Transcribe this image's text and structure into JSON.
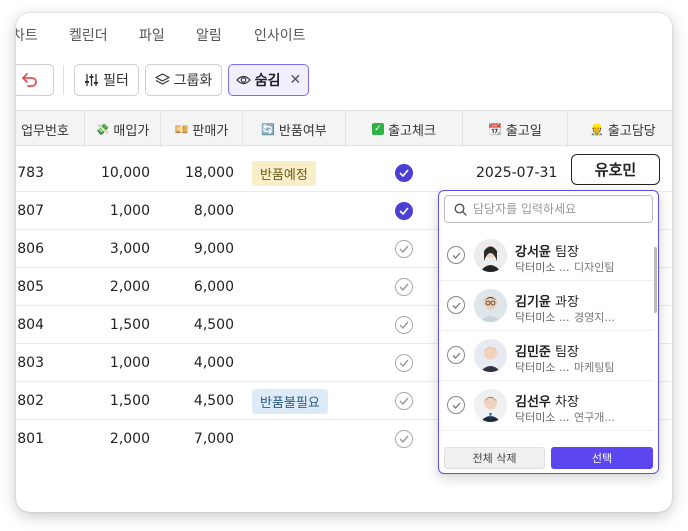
{
  "nav": {
    "tabs": [
      "차트",
      "켈린더",
      "파일",
      "알림",
      "인사이트"
    ]
  },
  "toolbar": {
    "filter_label": "필터",
    "group_label": "그룹화",
    "hide_label": "숨김"
  },
  "table": {
    "headers": {
      "task_no": "업무번호",
      "buy_price": "매입가",
      "sell_price": "판매가",
      "return_status": "반품여부",
      "ship_check": "출고체크",
      "ship_date": "출고일",
      "ship_owner": "출고담당"
    },
    "rows": [
      {
        "task_no": "783",
        "buy_price": "10,000",
        "sell_price": "18,000",
        "return_status": "반품예정",
        "checked": true,
        "ship_date": "2025-07-31"
      },
      {
        "task_no": "807",
        "buy_price": "1,000",
        "sell_price": "8,000",
        "return_status": "",
        "checked": true,
        "ship_date": ""
      },
      {
        "task_no": "806",
        "buy_price": "3,000",
        "sell_price": "9,000",
        "return_status": "",
        "checked": false,
        "ship_date": ""
      },
      {
        "task_no": "805",
        "buy_price": "2,000",
        "sell_price": "6,000",
        "return_status": "",
        "checked": false,
        "ship_date": ""
      },
      {
        "task_no": "804",
        "buy_price": "1,500",
        "sell_price": "4,500",
        "return_status": "",
        "checked": false,
        "ship_date": ""
      },
      {
        "task_no": "803",
        "buy_price": "1,000",
        "sell_price": "4,000",
        "return_status": "",
        "checked": false,
        "ship_date": ""
      },
      {
        "task_no": "802",
        "buy_price": "1,500",
        "sell_price": "4,500",
        "return_status": "반품불필요",
        "checked": false,
        "ship_date": ""
      },
      {
        "task_no": "801",
        "buy_price": "2,000",
        "sell_price": "7,000",
        "return_status": "",
        "checked": false,
        "ship_date": ""
      }
    ]
  },
  "owner_chip": "유호민",
  "dropdown": {
    "search_placeholder": "담당자를 입력하세요",
    "people": [
      {
        "name": "강서윤",
        "title": "팀장",
        "org": "닥터미소 ...",
        "dept": "디자인팀"
      },
      {
        "name": "김기윤",
        "title": "과장",
        "org": "닥터미소 ...",
        "dept": "경영지..."
      },
      {
        "name": "김민준",
        "title": "팀장",
        "org": "닥터미소 ...",
        "dept": "마케팅팀"
      },
      {
        "name": "김선우",
        "title": "차장",
        "org": "닥터미소 ...",
        "dept": "연구개..."
      }
    ],
    "clear_label": "전체 삭제",
    "select_label": "선택"
  },
  "colors": {
    "accent": "#5b46f0",
    "check_on": "#4b3fd6",
    "tag_yellow": "#f8efc8",
    "tag_blue": "#dcebf7"
  }
}
